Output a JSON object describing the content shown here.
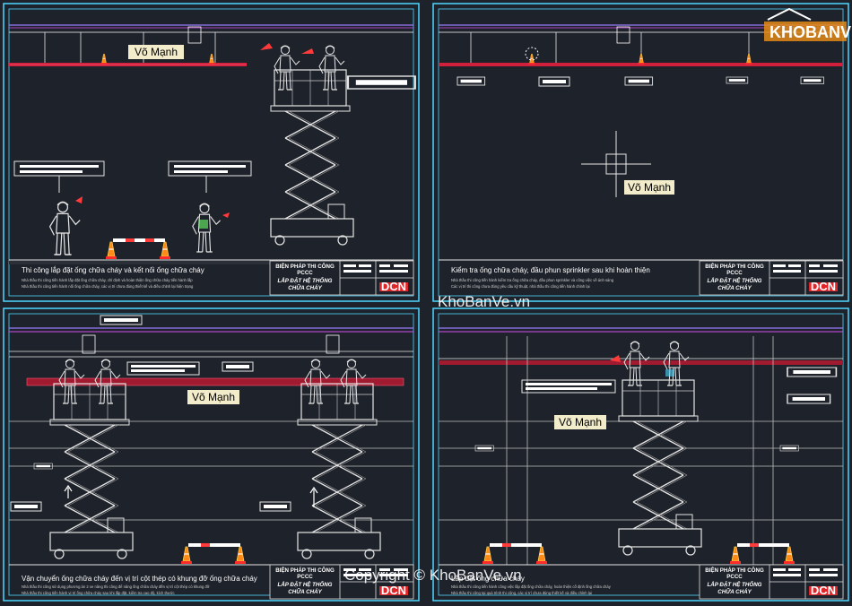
{
  "watermark_name": "Võ Mạnh",
  "site_logo": "KHOBANVE",
  "site_mark": "KhoBanVe.vn",
  "copyright_text": "Copyright © KhoBanVe.vn",
  "title_block": {
    "line1": "BIỆN PHÁP THI CÔNG",
    "line2": "PCCC",
    "line3": "LẮP ĐẶT HỆ THỐNG",
    "line4": "CHỮA CHÁY",
    "logo": "DCN"
  },
  "panels": [
    {
      "caption": "Thi công lắp đặt ống chữa cháy và kết nối ống chữa cháy",
      "note1": "Nhà thầu thi công tiến hành lắp đặt ống chữa cháy, chỉ định và hoàn thiện ống chữa cháy tiến hành lắp",
      "note2": "Nhà thầu thi công tiến hành nối ống chữa cháy, các vị trí chưa đúng thiết kế và điều chỉnh lại hiện trạng"
    },
    {
      "caption": "Kiểm tra ống chữa cháy, đầu phun sprinkler sau khi hoàn thiện",
      "note1": "Nhà thầu thi công tiến hành kiểm tra ống chữa cháy, đầu phun sprinkler và công việc về ánh sáng",
      "note2": "Các vị trí thi công chưa đúng yêu cầu kỹ thuật, nhà thầu thi công tiến hành chỉnh lại"
    },
    {
      "caption": "Vận chuyển ống chữa cháy đến vị trí cột thép có khung đỡ ống chữa cháy",
      "note1": "Nhà thầu thi công sử dụng phương án 2 xe nâng thi công để nâng ống chữa cháy đến vị trí cột thép có khung đỡ",
      "note2": "Nhà thầu thi công tiến hành vị trí ống chữa cháy sau khi lắp đặt, kiểm tra cao độ, kích thước"
    },
    {
      "caption": "Lắp đặt ống chữa cháy",
      "note1": "Nhà thầu thi công tiến hành công việc lắp đặt ống chữa cháy, hoàn thiện cố định ống chữa cháy",
      "note2": "Nhà thầu thi công tại quá trình thi công, các vị trí chưa đúng thiết kế và điều chỉnh lại"
    }
  ]
}
